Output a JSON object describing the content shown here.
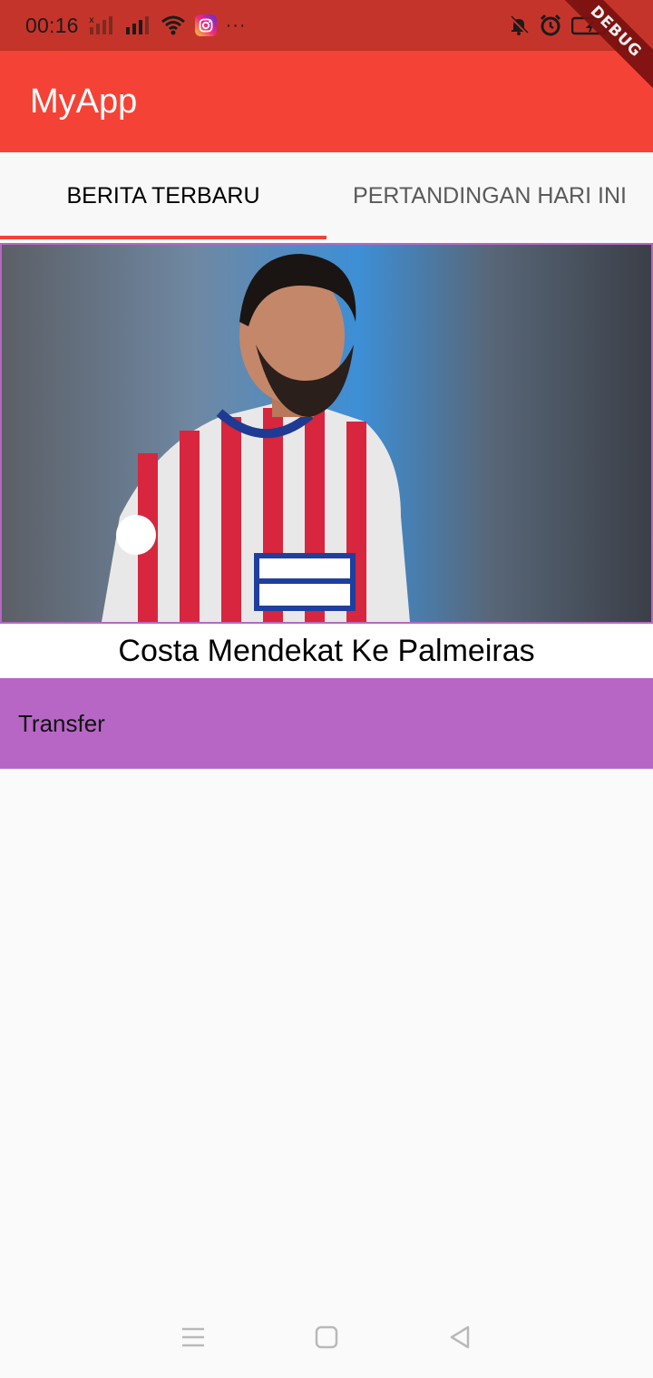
{
  "status_bar": {
    "time": "00:16",
    "icons": [
      "no-signal-icon",
      "signal-icon",
      "wifi-icon",
      "instagram-icon",
      "more-dots-icon",
      "bell-off-icon",
      "alarm-icon",
      "battery-icon"
    ],
    "more": "···"
  },
  "debug_banner": "DEBUG",
  "app_bar": {
    "title": "MyApp",
    "color": "#f44336"
  },
  "tabs": [
    {
      "label": "BERITA TERBARU",
      "active": true
    },
    {
      "label": "PERTANDINGAN HARI INI",
      "active": false
    }
  ],
  "news": [
    {
      "image_icon": "football-player-photo",
      "title": "Costa Mendekat Ke Palmeiras",
      "category": "Transfer",
      "category_color": "#b866c6"
    }
  ],
  "nav_bar": {
    "icons": [
      "menu-icon",
      "home-square-icon",
      "back-triangle-icon"
    ]
  }
}
